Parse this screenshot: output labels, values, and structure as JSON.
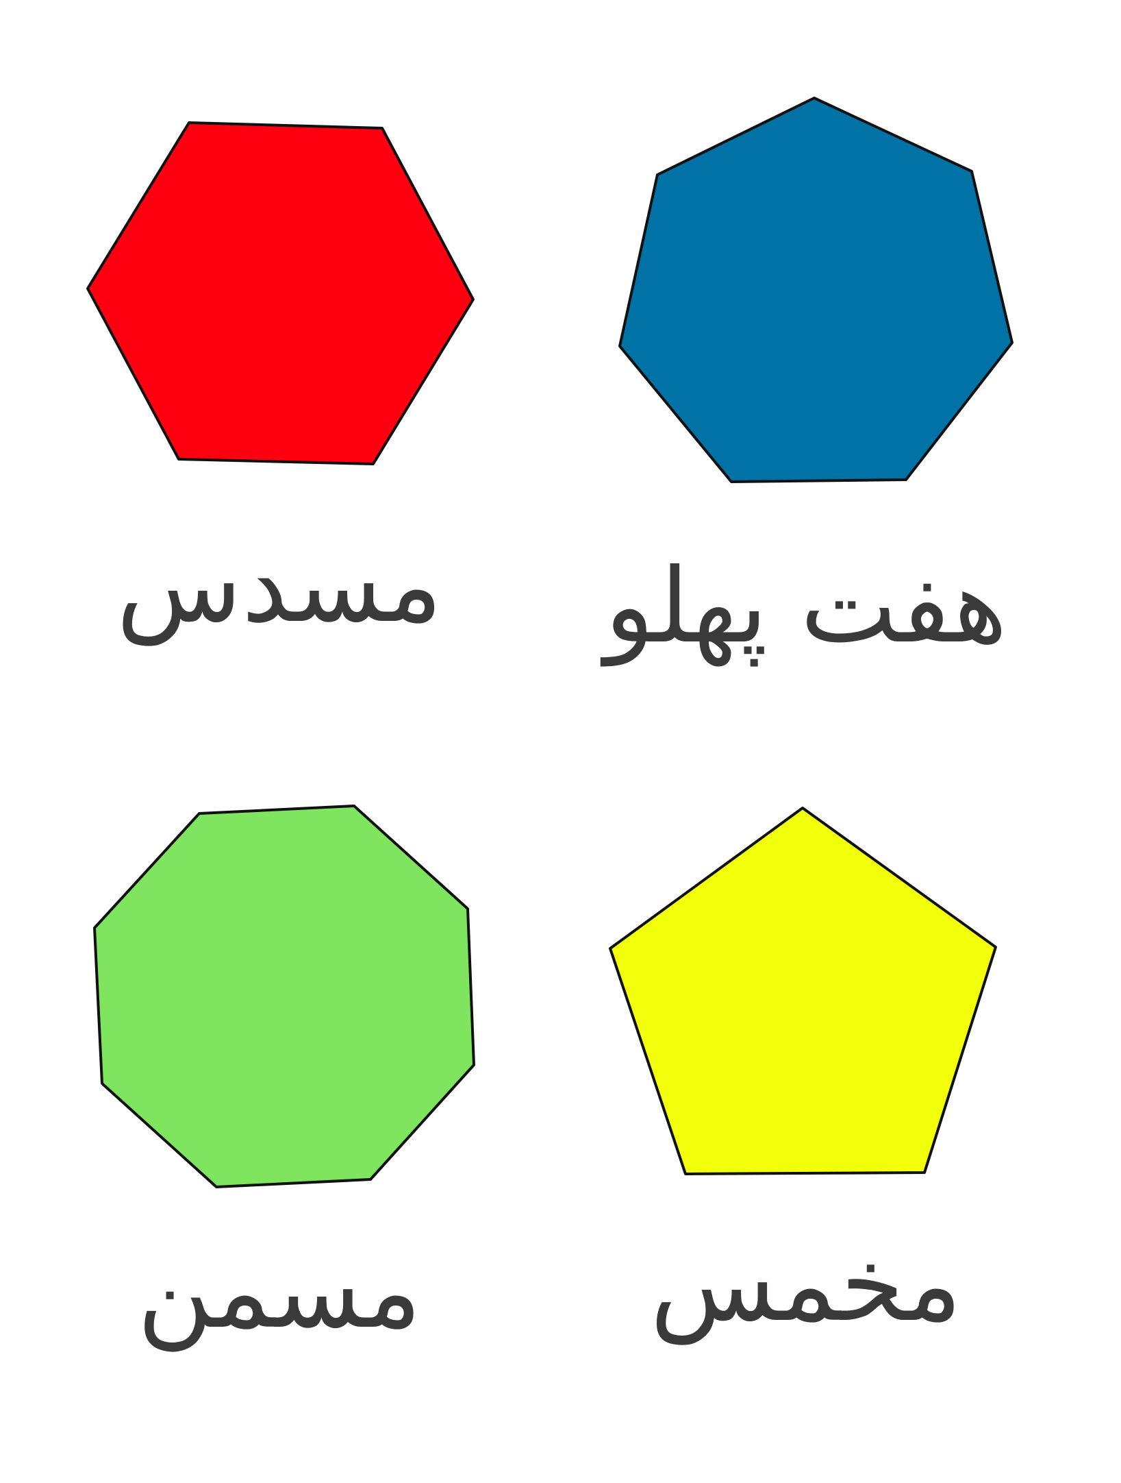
{
  "shapes": [
    {
      "id": "hexagon",
      "sides": 6,
      "label": "مسدس",
      "fill": "#ff0010"
    },
    {
      "id": "heptagon",
      "sides": 7,
      "label": "هفت پهلو",
      "fill": "#0072a6"
    },
    {
      "id": "octagon",
      "sides": 8,
      "label": "مسمن",
      "fill": "#80e55e"
    },
    {
      "id": "pentagon",
      "sides": 5,
      "label": "مخمس",
      "fill": "#f2ff0a"
    }
  ],
  "colors": {
    "outline": "#111111",
    "label_text": "#3a3a3a",
    "background": "#ffffff"
  }
}
